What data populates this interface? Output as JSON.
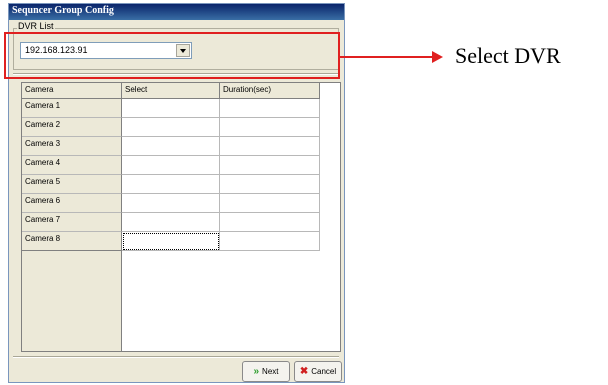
{
  "window": {
    "title": "Sequncer Group Config"
  },
  "dvr_list": {
    "group_label": "DVR List",
    "selected": "192.168.123.91"
  },
  "table": {
    "headers": [
      "Camera",
      "Select",
      "Duration(sec)"
    ],
    "rows": [
      {
        "camera": "Camera 1",
        "select": "",
        "duration": ""
      },
      {
        "camera": "Camera 2",
        "select": "",
        "duration": ""
      },
      {
        "camera": "Camera 3",
        "select": "",
        "duration": ""
      },
      {
        "camera": "Camera 4",
        "select": "",
        "duration": ""
      },
      {
        "camera": "Camera 5",
        "select": "",
        "duration": ""
      },
      {
        "camera": "Camera 6",
        "select": "",
        "duration": ""
      },
      {
        "camera": "Camera 7",
        "select": "",
        "duration": ""
      },
      {
        "camera": "Camera 8",
        "select": "",
        "duration": ""
      }
    ]
  },
  "buttons": {
    "next_label": "Next",
    "cancel_label": "Cancel"
  },
  "icons": {
    "next": "double-chevron-right-icon",
    "cancel": "x-icon"
  },
  "annotation": {
    "text": "Select DVR",
    "color": "#e02020"
  }
}
